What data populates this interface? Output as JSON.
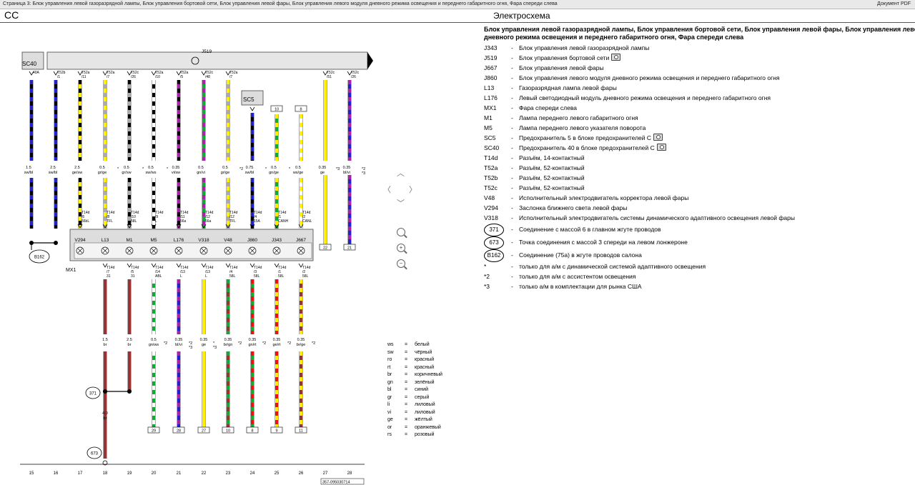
{
  "topbar": {
    "path": "Страница 3: Блок управления левой газоразрядной лампы, Блок управления бортовой сети, Блок управления левой фары, Блок управления левого модуля дневного режима освещения и переднего габаритного огня, Фара спереди слева",
    "pdf": "Документ PDF"
  },
  "header": {
    "code": "CC",
    "title": "Электросхема"
  },
  "legend": {
    "title_line1": "Блок управления левой газоразрядной лампы, Блок управления бортовой сети, Блок управления левой фары, Блок управления левого модуля",
    "title_line2": "дневного режима освещения и переднего габаритного огня, Фара спереди слева",
    "items": [
      {
        "code": "J343",
        "desc": "Блок управления левой газоразрядной лампы"
      },
      {
        "code": "J519",
        "desc": "Блок управления бортовой сети",
        "cam": true
      },
      {
        "code": "J667",
        "desc": "Блок управления левой фары"
      },
      {
        "code": "J860",
        "desc": "Блок управления левого модуля дневного режима освещения и переднего габаритного огня"
      },
      {
        "code": "L13",
        "desc": "Газоразрядная лампа левой фары"
      },
      {
        "code": "L176",
        "desc": "Левый светодиодный модуль дневного режима освещения и переднего габаритного огня"
      },
      {
        "code": "MX1",
        "desc": "Фара спереди слева"
      },
      {
        "code": "M1",
        "desc": "Лампа переднего левого габаритного огня"
      },
      {
        "code": "M5",
        "desc": "Лампа переднего левого указателя поворота"
      },
      {
        "code": "SC5",
        "desc": "Предохранитель 5 в блоке предохранителей С",
        "cam": true
      },
      {
        "code": "SC40",
        "desc": "Предохранитель 40 в блоке предохранителей С",
        "cam": true
      },
      {
        "code": "T14d",
        "desc": "Разъём, 14-контактный"
      },
      {
        "code": "T52a",
        "desc": "Разъём, 52-контактный"
      },
      {
        "code": "T52b",
        "desc": "Разъём, 52-контактный"
      },
      {
        "code": "T52c",
        "desc": "Разъём, 52-контактный"
      },
      {
        "code": "V48",
        "desc": "Исполнительный электродвигатель корректора левой фары"
      },
      {
        "code": "V294",
        "desc": "Заслонка ближнего света левой фары"
      },
      {
        "code": "V318",
        "desc": "Исполнительный электродвигатель системы динамического адаптивного освещения левой фары"
      }
    ],
    "circles": [
      {
        "code": "371",
        "desc": "Соединение с массой 6 в главном жгуте проводов"
      },
      {
        "code": "673",
        "desc": "Точка соединения с массой 3 спереди на левом лонжероне"
      },
      {
        "code": "B162",
        "desc": "Соединение (75a) в жгуте проводов салона"
      }
    ],
    "notes": [
      {
        "code": "*",
        "desc": "только для а/м с динамической системой адаптивного освещения"
      },
      {
        "code": "*2",
        "desc": "только для а/м с ассистентом освещения"
      },
      {
        "code": "*3",
        "desc": "только а/м в комплектации для рынка США"
      }
    ]
  },
  "colors_legend": [
    {
      "abbr": "ws",
      "name": "белый"
    },
    {
      "abbr": "sw",
      "name": "чёрный"
    },
    {
      "abbr": "ro",
      "name": "красный"
    },
    {
      "abbr": "rt",
      "name": "красный"
    },
    {
      "abbr": "br",
      "name": "коричневый"
    },
    {
      "abbr": "gn",
      "name": "зелёный"
    },
    {
      "abbr": "bl",
      "name": "синий"
    },
    {
      "abbr": "gr",
      "name": "серый"
    },
    {
      "abbr": "li",
      "name": "лиловый"
    },
    {
      "abbr": "vi",
      "name": "лиловый"
    },
    {
      "abbr": "ge",
      "name": "жёлтый"
    },
    {
      "abbr": "or",
      "name": "оранжевый"
    },
    {
      "abbr": "rs",
      "name": "розовый"
    }
  ],
  "diagram": {
    "j519_label": "J519",
    "sc40_label": "SC40",
    "sc5_label": "SC5",
    "mx1_label": "MX1",
    "b162_label": "B162",
    "ground_371": "371",
    "ground_673": "673",
    "doc_number": "357-095030714",
    "wire_colors": {
      "bl": "#2222cc",
      "sw": "#000000",
      "ge": "#ffee00",
      "gr": "#aaaaaa",
      "ws": "#ffffff",
      "gn": "#11aa33",
      "vi": "#aa22aa",
      "br": "#993333",
      "rt": "#ee1111",
      "blue_solid": "#2222cc"
    },
    "upper_wires": [
      {
        "num": "15",
        "conn": "40A",
        "conn2": "",
        "gauge": "1.5",
        "color": "sw/bl"
      },
      {
        "num": "16",
        "conn": "T52b",
        "conn2": "/1",
        "gauge": "2.5",
        "color": "sw/bl"
      },
      {
        "num": "17",
        "conn": "T52a",
        "conn2": "/11",
        "gauge": "2.5",
        "color": "ge/sw",
        "bconn": "T14d",
        "bconn2": "/6",
        "bsig": "56bL"
      },
      {
        "num": "18",
        "conn": "T52a",
        "conn2": "/7",
        "gauge": "0.5",
        "color": "gr/ge",
        "bconn": "T14d",
        "bconn2": "/8",
        "bsig": "TFL"
      },
      {
        "num": "19",
        "conn": "T52c",
        "conn2": "/26",
        "gauge": "0.5",
        "color": "gr/sw",
        "bconn": "T14d",
        "bconn2": "/10",
        "bsig": "58L"
      },
      {
        "num": "20",
        "conn": "T52a",
        "conn2": "/10",
        "gauge": "0.5",
        "color": "sw/ws",
        "bconn": "T14d",
        "bconn2": "/9",
        "bsig": "L"
      },
      {
        "num": "21",
        "conn": "T52a",
        "conn2": "/5",
        "gauge": "0.35",
        "color": "vi/sw",
        "bconn": "T14d",
        "bconn2": "/11",
        "bsig": "56a"
      },
      {
        "num": "22",
        "conn": "T52c",
        "conn2": "/48",
        "gauge": "0.5",
        "color": "gn/vi",
        "bconn": "T14d",
        "bconn2": "/12",
        "bsig": "56a"
      },
      {
        "num": "23",
        "conn": "T52a",
        "conn2": "/7",
        "gauge": "0.5",
        "color": "gr/ge",
        "bconn": "T14d",
        "bconn2": "/12",
        "bsig": "TFL"
      },
      {
        "num": "24",
        "conn": "",
        "conn2": "",
        "gauge": "0.75",
        "color": "sw/bl",
        "bconn": "T14d",
        "bconn2": "/4",
        "bsig": "15A"
      },
      {
        "num": "25",
        "conn": "10",
        "conn2": "",
        "gauge": "0.5",
        "color": "gn/ge",
        "bconn": "T14d",
        "bconn2": "/1",
        "bsig": "CANH"
      },
      {
        "num": "26",
        "conn": "8",
        "conn2": "",
        "gauge": "0.5",
        "color": "ws/ge",
        "bconn": "T14d",
        "bconn2": "/2",
        "bsig": "CANL"
      },
      {
        "num": "27",
        "conn": "T52c",
        "conn2": "/51",
        "gauge": "0.35",
        "color": "ge",
        "bconn": "",
        "bconn2": "",
        "bsig": ""
      },
      {
        "num": "28",
        "conn": "T52c",
        "conn2": "/26",
        "gauge": "0.35",
        "color": "bl/vi",
        "bconn": "",
        "bconn2": "",
        "bsig": ""
      }
    ],
    "component_labels": [
      "V294",
      "L13",
      "M1",
      "M5",
      "L176",
      "V318",
      "V48",
      "J860",
      "J343",
      "J667"
    ],
    "lower_wires": [
      {
        "conn": "T14d",
        "conn2": "/7",
        "sig": "31",
        "gauge": "1.5",
        "color": "br"
      },
      {
        "conn": "T14d",
        "conn2": "/5",
        "sig": "31",
        "gauge": "2.5",
        "color": "br"
      },
      {
        "conn": "T14d",
        "conn2": "/14",
        "sig": "ABL",
        "gauge": "0.5",
        "color": "gn/ws",
        "dest": "29"
      },
      {
        "conn": "T14d",
        "conn2": "/13",
        "sig": "L",
        "gauge": "0.35",
        "color": "bl/vi",
        "dest": "28"
      },
      {
        "conn": "T14d",
        "conn2": "/13",
        "sig": "L",
        "gauge": "0.35",
        "color": "ge",
        "dest": "27"
      },
      {
        "conn": "T14d",
        "conn2": "/4",
        "sig": "58L",
        "gauge": "0.35",
        "color": "br/gn",
        "dest": "10"
      },
      {
        "conn": "T14d",
        "conn2": "/3",
        "sig": "58L",
        "gauge": "0.35",
        "color": "gn/rt",
        "dest": "8"
      },
      {
        "conn": "T14d",
        "conn2": "/1",
        "sig": "58L",
        "gauge": "0.35",
        "color": "ge/rt",
        "dest": "9"
      },
      {
        "conn": "T14d",
        "conn2": "/2",
        "sig": "58L",
        "gauge": "0.35",
        "color": "br/ge",
        "dest": "11"
      }
    ],
    "br_joint_gauge": "4.0",
    "br_joint_color": "br",
    "upper_right_boxes": [
      "22",
      "21"
    ],
    "footnote_marks": {
      "star": "*",
      "star2": "*2",
      "star3": "*3"
    },
    "bottom_numbers": [
      "15",
      "16",
      "17",
      "18",
      "19",
      "20",
      "21",
      "22",
      "23",
      "24",
      "25",
      "26",
      "27",
      "28"
    ]
  },
  "nav": {
    "up": "⌃",
    "left": "❮",
    "right": "❯",
    "down": "⌄",
    "zoom_in": "+",
    "zoom_out": "−",
    "zoom_fit": "·"
  }
}
